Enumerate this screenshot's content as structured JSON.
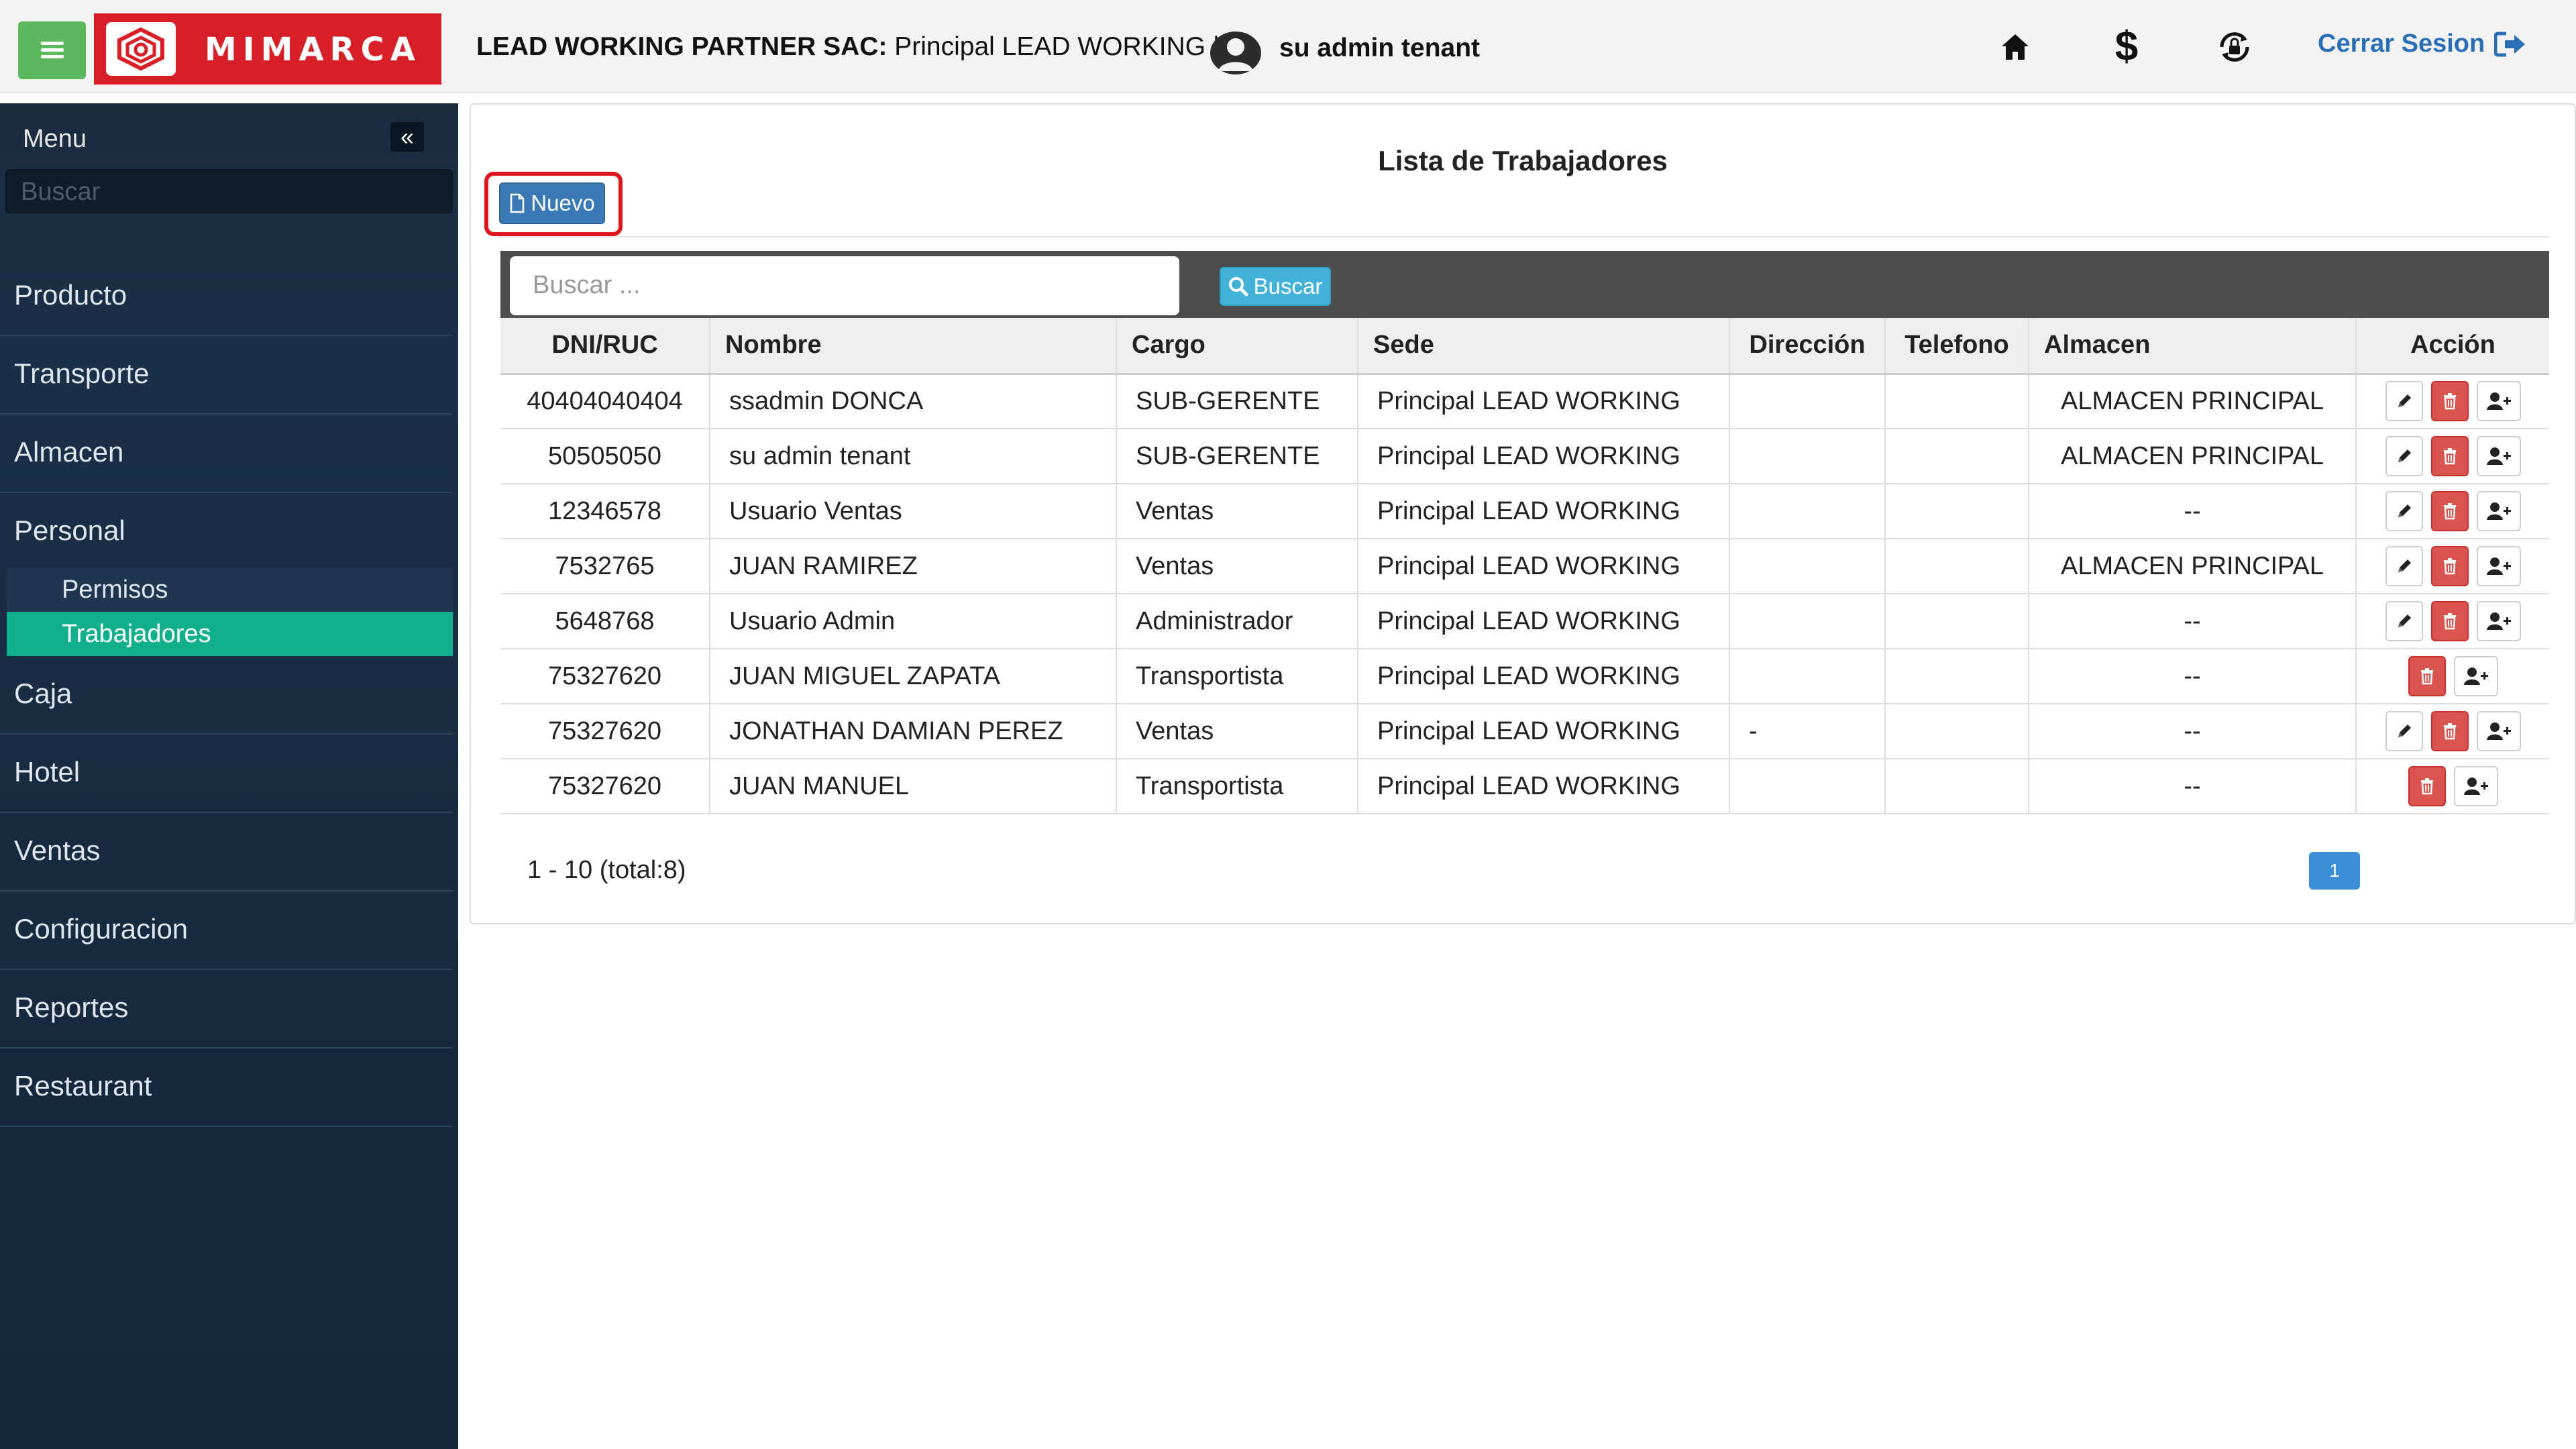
{
  "header": {
    "brand": "MIMARCA",
    "company_label": "LEAD WORKING PARTNER SAC:",
    "company_branch": "Principal LEAD WORKING |",
    "user": "su admin tenant",
    "logout": "Cerrar Sesion"
  },
  "sidebar": {
    "title": "Menu",
    "search_placeholder": "Buscar",
    "items": [
      "Producto",
      "Transporte",
      "Almacen",
      "Personal",
      "Caja",
      "Hotel",
      "Ventas",
      "Configuracion",
      "Reportes",
      "Restaurant"
    ],
    "subitems": [
      "Permisos",
      "Trabajadores"
    ],
    "active_subitem": "Trabajadores"
  },
  "main": {
    "title": "Lista de Trabajadores",
    "new_button": "Nuevo",
    "search_placeholder": "Buscar ...",
    "search_button": "Buscar",
    "columns": [
      "DNI/RUC",
      "Nombre",
      "Cargo",
      "Sede",
      "Dirección",
      "Telefono",
      "Almacen",
      "Acción"
    ],
    "rows": [
      {
        "dni": "40404040404",
        "nombre": "ssadmin DONCA",
        "cargo": "SUB-GERENTE",
        "sede": "Principal LEAD WORKING",
        "direccion": "",
        "telefono": "",
        "almacen": "ALMACEN PRINCIPAL",
        "edit": true
      },
      {
        "dni": "50505050",
        "nombre": "su admin tenant",
        "cargo": "SUB-GERENTE",
        "sede": "Principal LEAD WORKING",
        "direccion": "",
        "telefono": "",
        "almacen": "ALMACEN PRINCIPAL",
        "edit": true
      },
      {
        "dni": "12346578",
        "nombre": "Usuario Ventas",
        "cargo": "Ventas",
        "sede": "Principal LEAD WORKING",
        "direccion": "",
        "telefono": "",
        "almacen": "--",
        "edit": true
      },
      {
        "dni": "7532765",
        "nombre": "JUAN RAMIREZ",
        "cargo": "Ventas",
        "sede": "Principal LEAD WORKING",
        "direccion": "",
        "telefono": "",
        "almacen": "ALMACEN PRINCIPAL",
        "edit": true
      },
      {
        "dni": "5648768",
        "nombre": "Usuario Admin",
        "cargo": "Administrador",
        "sede": "Principal LEAD WORKING",
        "direccion": "",
        "telefono": "",
        "almacen": "--",
        "edit": true
      },
      {
        "dni": "75327620",
        "nombre": "JUAN MIGUEL ZAPATA",
        "cargo": "Transportista",
        "sede": "Principal LEAD WORKING",
        "direccion": "",
        "telefono": "",
        "almacen": "--",
        "edit": false
      },
      {
        "dni": "75327620",
        "nombre": "JONATHAN DAMIAN PEREZ",
        "cargo": "Ventas",
        "sede": "Principal LEAD WORKING",
        "direccion": "-",
        "telefono": "",
        "almacen": "--",
        "edit": true
      },
      {
        "dni": "75327620",
        "nombre": "JUAN MANUEL",
        "cargo": "Transportista",
        "sede": "Principal LEAD WORKING",
        "direccion": "",
        "telefono": "",
        "almacen": "--",
        "edit": false
      }
    ],
    "pagination_info": "1 - 10 (total:8)",
    "current_page": "1"
  },
  "colors": {
    "accent": "#11b08c",
    "brand": "#d81e27",
    "primary_button": "#3a7ab4",
    "info_button": "#43b2d9",
    "danger_button": "#d9534f",
    "link": "#2a6fb5"
  },
  "icons": [
    "menu-icon",
    "logo-icon",
    "avatar-icon",
    "home-icon",
    "dollar-icon",
    "lock-refresh-icon",
    "logout-icon",
    "chevron-double-left-icon",
    "file-icon",
    "search-icon",
    "pencil-icon",
    "trash-icon",
    "user-plus-icon"
  ]
}
